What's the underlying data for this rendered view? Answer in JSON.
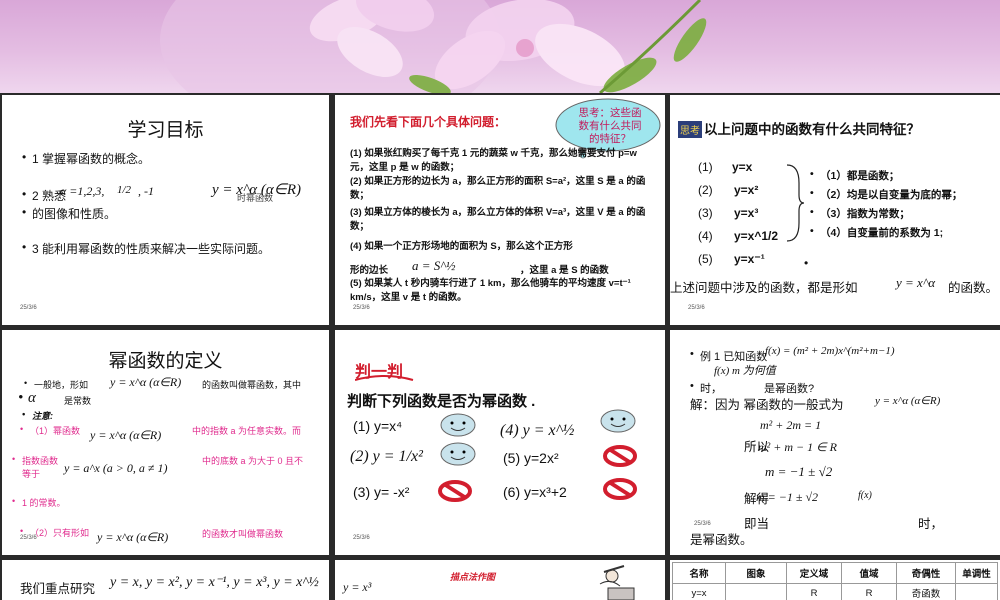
{
  "colors": {
    "banner": "#dcaedb",
    "petal": "#f6d3ef",
    "leaf": "#7cae3f",
    "cloud": "#9fe6ee",
    "red": "#d21e2e",
    "pink": "#e02c8e"
  },
  "date": "25/3/6",
  "s1": {
    "title": "学习目标",
    "b1": "1 掌握幂函数的概念。",
    "b2a": "2 熟悉",
    "b2set": "α =1,2,3,",
    "b2half": "1/2",
    "b2b": ", -1",
    "b2formula": "y = x^α (α∈R)",
    "b2c": "时幂函数",
    "b2d": "的图像和性质。",
    "b3": "3 能利用幂函数的性质来解决一些实际问题。"
  },
  "s2": {
    "title": "我们先看下面几个具体问题：",
    "cloud": "思考：这些函数有什么共同的特征？",
    "q1": "(1) 如果张红购买了每千克 1 元的蔬菜 w 千克，那么她需要支付 p=w 元，这里 p 是 w 的函数；",
    "q2": "(2) 如果正方形的边长为 a，那么正方形的面积 S=a²，这里 S 是 a 的函数；",
    "q3": "(3) 如果立方体的棱长为 a，那么立方体的体积 V=a³，这里 V 是 a 的函数；",
    "q4a": "(4) 如果一个正方形场地的面积为 S，那么这个正方形",
    "q4b": "形的边长",
    "q4formula": "a = S^½",
    "q4c": "，这里 a 是 S 的函数",
    "q5": "(5) 如果某人 t 秒内骑车行进了 1 km，那么他骑车的平均速度 v=t⁻¹ km/s，这里 v 是 t 的函数。"
  },
  "s3": {
    "stamp": "思考",
    "title": "以上问题中的函数有什么共同特征？",
    "fns": [
      [
        "(1)",
        "y=x"
      ],
      [
        "(2)",
        "y=x²"
      ],
      [
        "(3)",
        "y=x³"
      ],
      [
        "(4)",
        "y=x^1/2"
      ],
      [
        "(5)",
        "y=x⁻¹"
      ]
    ],
    "feats": [
      "（1）都是函数；",
      "（2）均是以自变量为底的幂；",
      "（3）指数为常数；",
      "（4）自变量前的系数为 1;"
    ],
    "concl": "上述问题中涉及的函数，都是形如",
    "conclf": "y = x^α",
    "conclend": "的函数。"
  },
  "s4": {
    "title": "幂函数的定义",
    "l1a": "一般地，形如",
    "f1": "y = x^α (α∈R)",
    "l1b": "的函数叫做幂函数，其中",
    "alpha": "α",
    "l2": "是常数",
    "note": "注意:",
    "n1a": "（1）幂函数",
    "n1f": "y = x^α (α∈R)",
    "n1b": "中的指数 a 为任意实数。而",
    "n2a": "指数函数",
    "n2f": "y = a^x (a > 0, a ≠ 1)",
    "n2b": "中的底数 a 为大于 0 且不",
    "n2c": "等于",
    "n3": "1 的常数。",
    "n4a": "（2）只有形如",
    "n4f": "y = x^α (α∈R)",
    "n4b": "的函数才叫做幂函数"
  },
  "s5": {
    "title": "判一判",
    "sub": "判断下列函数是否为幂函数 .",
    "items": [
      "(1) y=x⁴",
      "(4) y = x^½",
      "(2) y = 1/x²",
      "(5) y=2x²",
      "(3) y= -x²",
      "(6) y=x³+2"
    ]
  },
  "s6": {
    "ex": "例 1 已知函数",
    "exf": "f(x) = (m² + 2m)x^(m²+m−1)",
    "exq": "f(x) m 为何值",
    "when": "时，",
    "isp": "是幂函数?",
    "sol": "解：因为 幂函数的一般式为",
    "solf": "y = x^α (α∈R)",
    "eq1": "m² + 2m = 1",
    "so": "所以",
    "eq2": "m² + m − 1 ∈ R",
    "eq3": "m = −1 ± √2",
    "get": "解得",
    "eq4": "m = −1 ± √2",
    "fx": "f(x)",
    "dang": "即当",
    "shi": "时，",
    "last": "是幂函数。"
  },
  "s7": {
    "a": "我们重点研究",
    "f": "y = x, y = x², y = x⁻¹, y = x³, y = x^½"
  },
  "s8": {
    "title": "描点法作图",
    "f": "y = x³"
  },
  "s9": {
    "headers": [
      "名称",
      "图象",
      "定义域",
      "值域",
      "奇偶性",
      "单调性"
    ],
    "row": [
      "y=x",
      "",
      "R",
      "R",
      "奇函数",
      ""
    ]
  }
}
